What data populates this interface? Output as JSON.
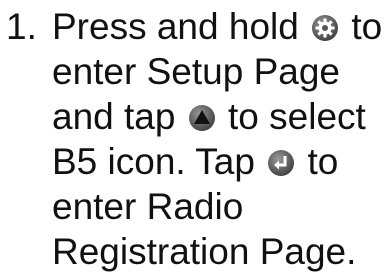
{
  "instruction": {
    "number": "1.",
    "line1_before": "Press and hold",
    "line1_after": "to",
    "line2": "enter Setup Page",
    "line3_before": "and tap",
    "line3_after": "to select",
    "line4_before": "B5 icon. Tap",
    "line4_after": "to",
    "line5": "enter Radio",
    "line6": "Registration Page."
  },
  "icons": {
    "setup": "gear-button-icon",
    "select": "up-arrow-button-icon",
    "enter": "enter-return-button-icon"
  }
}
